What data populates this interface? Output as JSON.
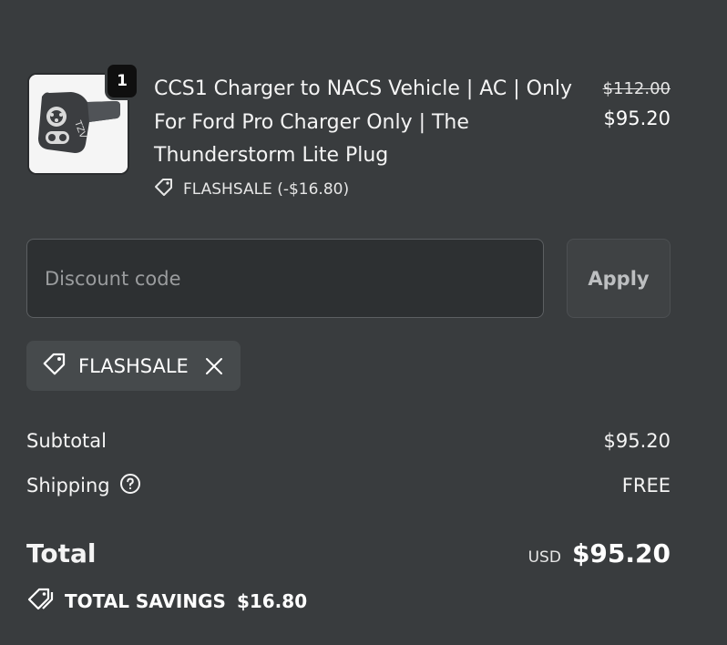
{
  "product": {
    "image": "ccs1-to-nacs-adapter-photo",
    "quantity": "1",
    "title": "CCS1 Charger to NACS Vehicle | AC | Only For Ford Pro Charger Only | The Thunderstorm Lite Plug",
    "discount_line": "FLASHSALE (-$16.80)",
    "price_original": "$112.00",
    "price_current": "$95.20",
    "image_brand_text": "TZV"
  },
  "discount": {
    "placeholder": "Discount code",
    "value": "",
    "apply_label": "Apply"
  },
  "applied_code": {
    "code": "FLASHSALE",
    "icon": "tag-icon",
    "remove_icon": "close-icon"
  },
  "summary": {
    "subtotal_label": "Subtotal",
    "subtotal_value": "$95.20",
    "shipping_label": "Shipping",
    "shipping_help_icon": "question-circle-icon",
    "shipping_value": "FREE",
    "total_label": "Total",
    "currency": "USD",
    "total_value": "$95.20",
    "savings_label": "TOTAL SAVINGS",
    "savings_value": "$16.80",
    "savings_icon": "tags-icon"
  },
  "colors": {
    "background": "#393c3e",
    "input_background": "#2d3032",
    "chip_background": "#464a4c",
    "text": "#f4f4f4"
  }
}
